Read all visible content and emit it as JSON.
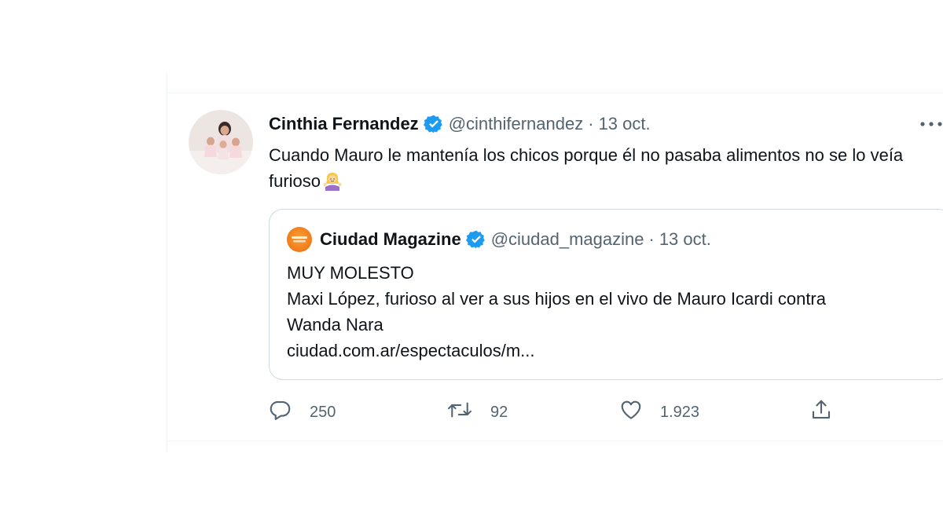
{
  "tweet": {
    "author_name": "Cinthia Fernandez",
    "handle": "@cinthifernandez",
    "separator": "·",
    "date": "13 oct.",
    "text": "Cuando Mauro le mantenía los chicos porque él no pasaba alimentos no se lo veía furioso",
    "emoji": "woman-shrugging-emoji",
    "more_icon": "more-horizontal-icon"
  },
  "quote": {
    "author_name": "Ciudad Magazine",
    "handle": "@ciudad_magazine",
    "separator": "·",
    "date": "13 oct.",
    "lines": [
      "MUY MOLESTO",
      "Maxi López, furioso al ver a sus hijos en el vivo de Mauro Icardi contra",
      "Wanda Nara",
      "ciudad.com.ar/espectaculos/m..."
    ]
  },
  "actions": {
    "reply_count": "250",
    "retweet_count": "92",
    "like_count": "1.923",
    "icons": [
      "reply-icon",
      "retweet-icon",
      "like-icon",
      "share-icon"
    ]
  },
  "colors": {
    "text_primary": "#0f1419",
    "text_secondary": "#536471",
    "verified": "#1d9bf0",
    "border": "#cfd9de",
    "brand_orange": "#f07a1a"
  }
}
